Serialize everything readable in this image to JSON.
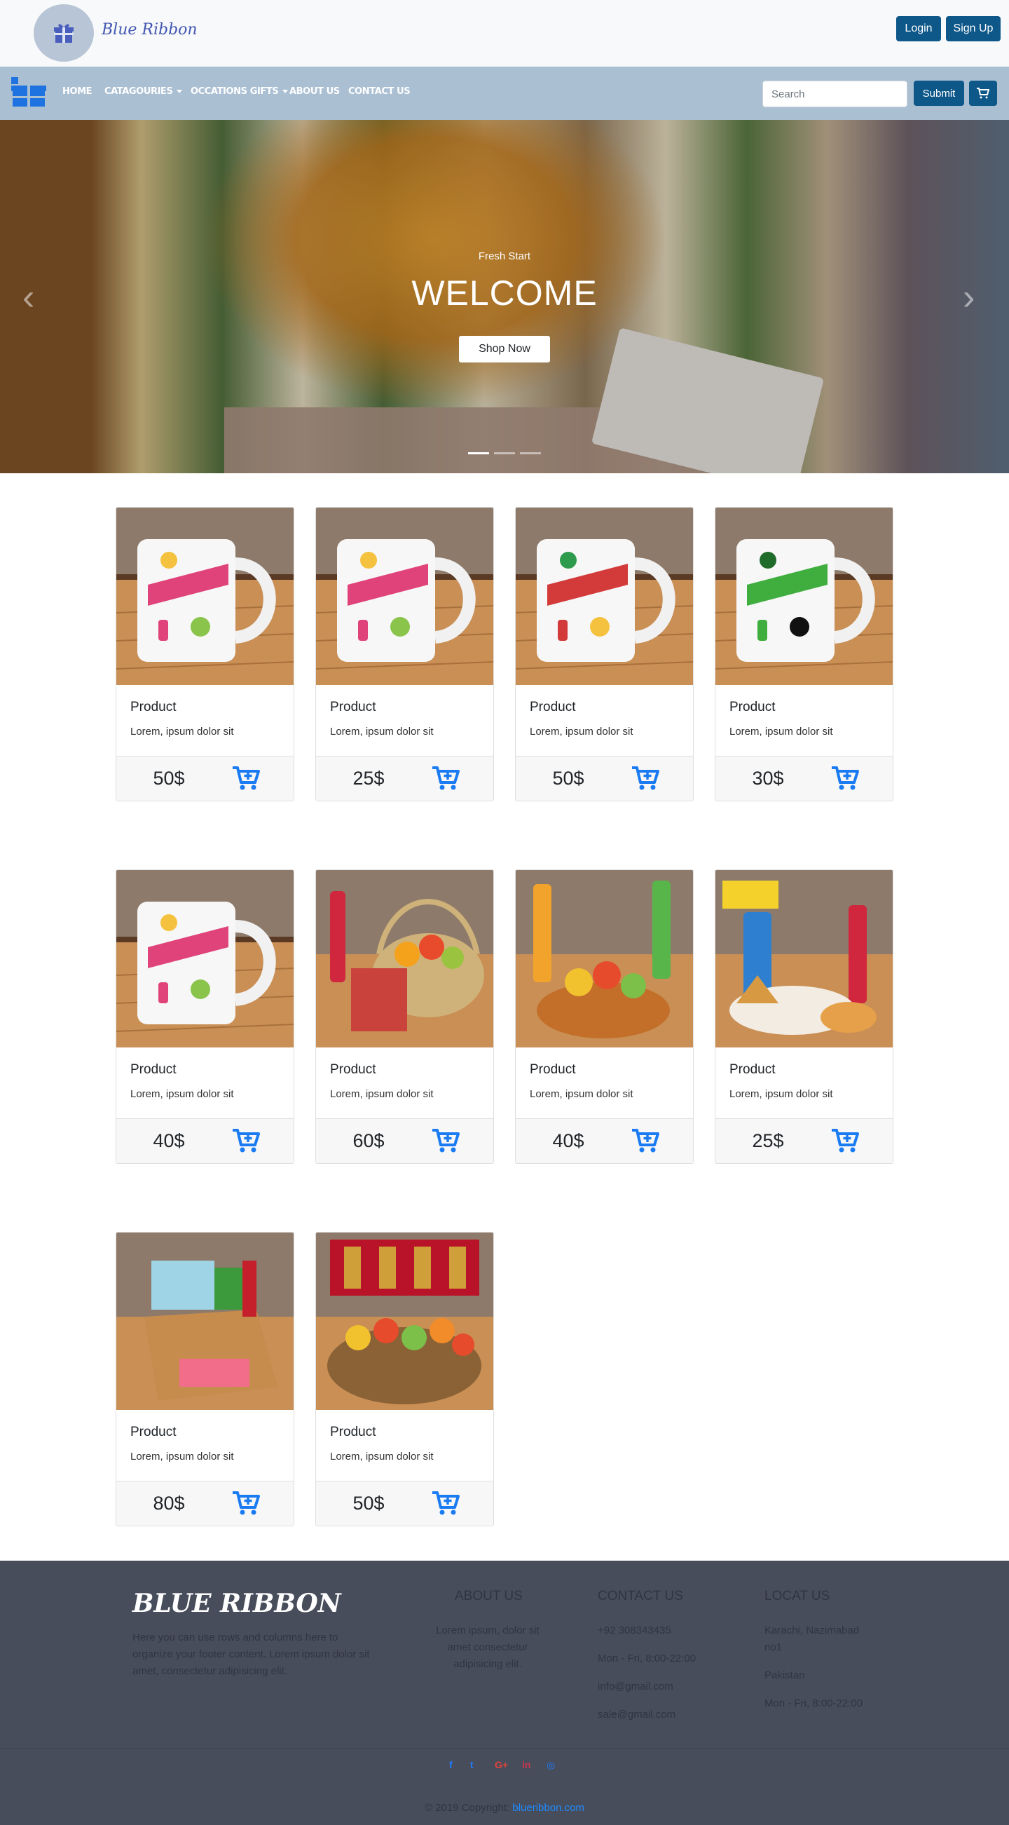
{
  "header": {
    "brand": "Blue Ribbon",
    "login_label": "Login",
    "signup_label": "Sign Up"
  },
  "nav": {
    "items": [
      {
        "label": "Home"
      },
      {
        "label": "Catagouries"
      },
      {
        "label": "Occations Gifts"
      },
      {
        "label": "About Us"
      },
      {
        "label": "Contact Us"
      }
    ],
    "search_placeholder": "Search",
    "submit_label": "Submit"
  },
  "hero": {
    "subtitle": "Fresh Start",
    "title": "WELCOME",
    "button_label": "Shop Now",
    "slide_count": 3,
    "active_slide": 1
  },
  "products": [
    {
      "title": "Product",
      "desc": "Lorem, ipsum dolor sit",
      "price": "50$",
      "image": "ramadan-kareem-mug"
    },
    {
      "title": "Product",
      "desc": "Lorem, ipsum dolor sit",
      "price": "25$",
      "image": "ramadan-kareem-mug"
    },
    {
      "title": "Product",
      "desc": "Lorem, ipsum dolor sit",
      "price": "50$",
      "image": "ramadan-mubarak-mug"
    },
    {
      "title": "Product",
      "desc": "Lorem, ipsum dolor sit",
      "price": "30$",
      "image": "green-ramadan-mug"
    },
    {
      "title": "Product",
      "desc": "Lorem, ipsum dolor sit",
      "price": "40$",
      "image": "ramadan-kareem-mug"
    },
    {
      "title": "Product",
      "desc": "Lorem, ipsum dolor sit",
      "price": "60$",
      "image": "fruit-basket"
    },
    {
      "title": "Product",
      "desc": "Lorem, ipsum dolor sit",
      "price": "40$",
      "image": "fruit-bowl-drinks"
    },
    {
      "title": "Product",
      "desc": "Lorem, ipsum dolor sit",
      "price": "25$",
      "image": "iftar-platter"
    },
    {
      "title": "Product",
      "desc": "Lorem, ipsum dolor sit",
      "price": "80$",
      "image": "grocery-box"
    },
    {
      "title": "Product",
      "desc": "Lorem, ipsum dolor sit",
      "price": "50$",
      "image": "fruit-hamper"
    }
  ],
  "footer": {
    "brand": "BLUE RIBBON",
    "about_text": "Here you can use rows and columns here to organize your footer content. Lorem ipsum dolor sit amet, consectetur adipisicing elit.",
    "about_us": {
      "heading": "ABOUT US",
      "text": "Lorem ipsum, dolor sit amet consectetur adipisicing elit."
    },
    "contact_us": {
      "heading": "CONTACT US",
      "lines": [
        "+92 308343435",
        "Mon - Fri, 8:00-22:00",
        "info@gmail.com",
        "sale@gmail.com"
      ]
    },
    "locate_us": {
      "heading": "LOCAT US",
      "lines": [
        "Karachi, Nazimabad no1",
        "Pakistan",
        "Mon - Fri, 8:00-22:00"
      ]
    },
    "social": [
      {
        "icon": "facebook-icon",
        "glyph": "f",
        "color": "#1f7bff"
      },
      {
        "icon": "twitter-icon",
        "glyph": "t",
        "color": "#1f7bff"
      },
      {
        "icon": "google-plus-icon",
        "glyph": "G+",
        "color": "#e0453a"
      },
      {
        "icon": "linkedin-icon",
        "glyph": "in",
        "color": "#c8364f"
      },
      {
        "icon": "instagram-icon",
        "glyph": "◎",
        "color": "#1f7bff"
      }
    ],
    "copyright_prefix": "© 2019 Copyright:",
    "copyright_link": "blueribbon.com"
  },
  "colors": {
    "primary_button": "#0d5789",
    "navbar": "#abbfd3",
    "cart_icon": "#1a7bf2",
    "footer_bg": "#474d5b"
  }
}
